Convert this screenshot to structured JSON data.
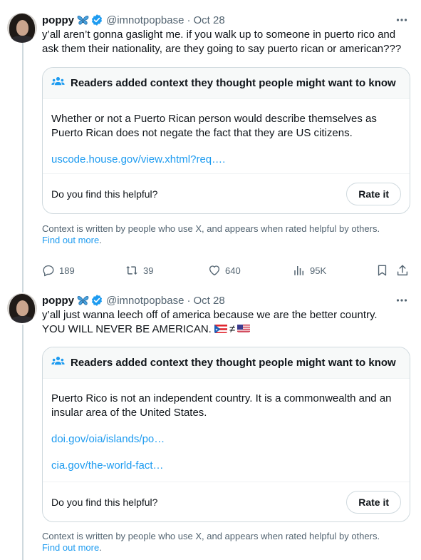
{
  "tweets": [
    {
      "name": "poppy",
      "handle": "@imnotpopbase",
      "dot": "·",
      "time": "Oct 28",
      "text": "y’all aren’t gonna gaslight me. if you walk up to someone in puerto rico and ask them their nationality, are they going to say puerto rican or american???",
      "note": {
        "header": "Readers added context they thought people might want to know",
        "body": "Whether or not a Puerto Rican person would describe themselves as Puerto Rican does not negate the fact that they are US citizens.",
        "links": [
          "uscode.house.gov/view.xhtml?req…."
        ],
        "helpful_prompt": "Do you find this helpful?",
        "rate_label": "Rate it"
      },
      "context_text": "Context is written by people who use X, and appears when rated helpful by others.",
      "find_out_more": "Find out more",
      "period": ".",
      "stats": {
        "replies": "189",
        "reposts": "39",
        "likes": "640",
        "views": "95K"
      }
    },
    {
      "name": "poppy",
      "handle": "@imnotpopbase",
      "dot": "·",
      "time": "Oct 28",
      "text_line1": "y’all just wanna leech off of america because we are the better country.",
      "text_line2": "YOU WILL NEVER BE AMERICAN.",
      "neq": "≠",
      "note": {
        "header": "Readers added context they thought people might want to know",
        "body": "Puerto Rico is not an independent country. It is a commonwealth and an insular area of the United States.",
        "links": [
          "doi.gov/oia/islands/po…",
          "cia.gov/the-world-fact…"
        ],
        "helpful_prompt": "Do you find this helpful?",
        "rate_label": "Rate it"
      },
      "context_text": "Context is written by people who use X, and appears when rated helpful by others.",
      "find_out_more": "Find out more",
      "period": "."
    }
  ],
  "icons": [
    "butterfly-emoji",
    "verified-badge",
    "more-icon",
    "readers-icon",
    "reply-icon",
    "repost-icon",
    "like-icon",
    "views-icon",
    "bookmark-icon",
    "share-icon",
    "puerto-rico-flag",
    "us-flag"
  ],
  "colors": {
    "link": "#1d9bf0",
    "secondary": "#536471",
    "verified": "#1d9bf0",
    "border": "#cfd9de",
    "note_header_bg": "#f7f9f9"
  }
}
